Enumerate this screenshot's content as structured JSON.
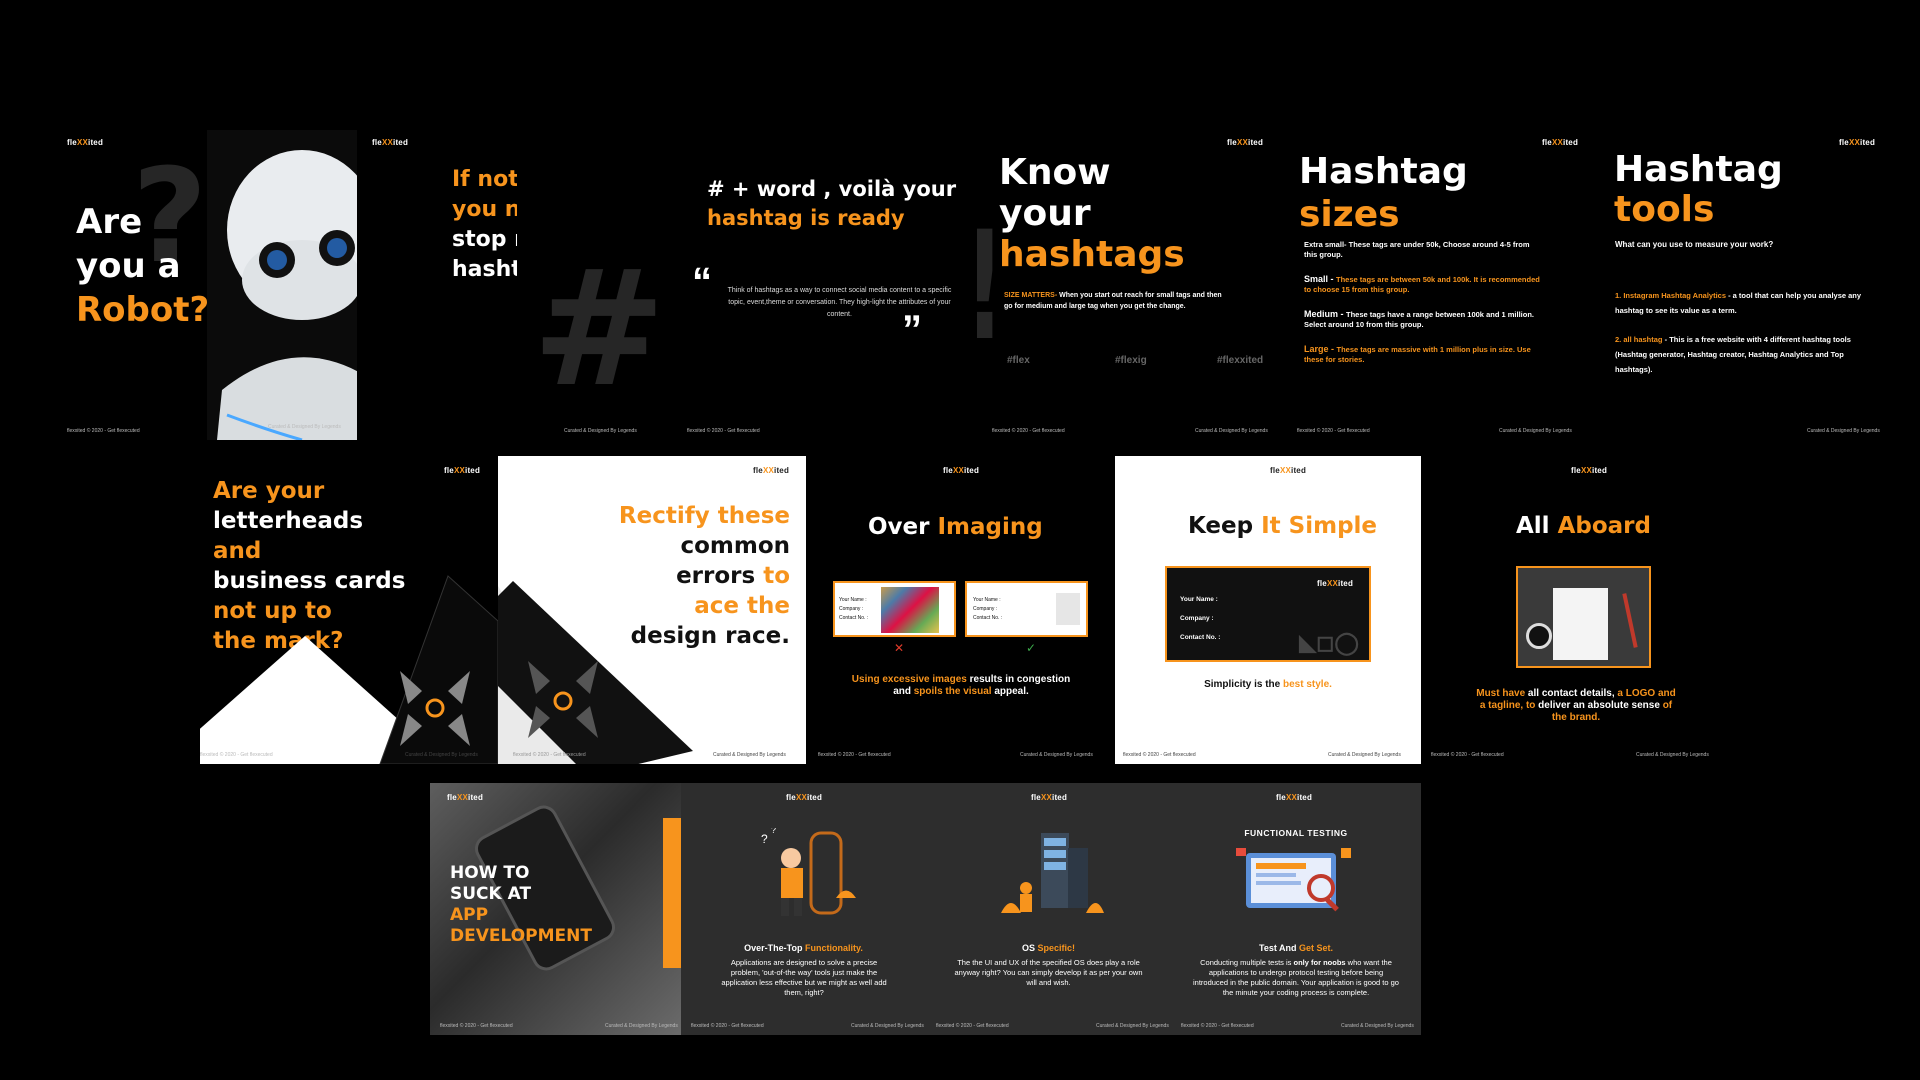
{
  "brand": {
    "logo": "fleXXited",
    "accent": "#f7941d"
  },
  "footers": {
    "copy": "flexxited © 2020 - Get flexecuted",
    "credit": "Curated & Designed By Legends"
  },
  "s1": {
    "l1": "Are",
    "l2": "you a",
    "l3": "Robot?"
  },
  "s2": {
    "l1": "If not then",
    "l2": "you need to",
    "l3": "stop repeating",
    "l4": "hashtags."
  },
  "s3": {
    "h1": "# + word , voilà your",
    "h2": "hashtag is ready",
    "quote": "Think of hashtags as a way to connect social media content to a specific topic, event,theme or conversation. They high-light the attributes of your content."
  },
  "s4": {
    "t1": "Know",
    "t2": "your",
    "t3": "hashtags",
    "sm_label": "SIZE MATTERS-",
    "sm_text": " When you start out reach for small tags and then go for medium and large tag when you get the change.",
    "tags": [
      "#flex",
      "#flexig",
      "#flexxited"
    ]
  },
  "s5": {
    "t1": "Hashtag",
    "t2": "sizes",
    "xs_label": "Extra small-",
    "xs_text": " These tags are under 50k, Choose around 4-5 from this group.",
    "sm_label": "Small - ",
    "sm_text": "These tags are between 50k and 100k. It is recommended to choose 15 from this group.",
    "md_label": "Medium - ",
    "md_text": "These tags have a range between 100k and 1 million. Select around 10 from this group.",
    "lg_label": "Large - ",
    "lg_text": "These tags are massive with 1 million plus in size. Use these for stories."
  },
  "s6": {
    "t1": "Hashtag",
    "t2": "tools",
    "q": "What can you use to measure your work?",
    "i1_label": "1. Instagram Hashtag Analytics",
    "i1_text": " - a tool that can help you analyse any hashtag to see its value as a term.",
    "i2_label": "2. all hashtag",
    "i2_text": " - This is a free website with 4 different hashtag tools (Hashtag generator, Hashtag creator, Hashtag Analytics and Top hashtags)."
  },
  "s7": {
    "l1": "Are your",
    "l2": "letterheads",
    "l3": "and",
    "l4": "business cards",
    "l5": "not up to",
    "l6": "the mark?"
  },
  "s8": {
    "l1": "Rectify these",
    "l2": "common",
    "l3": "errors",
    "l3b": " to",
    "l4": "ace the",
    "l5": "design race."
  },
  "s9": {
    "t1": "Over ",
    "t2": "Imaging",
    "card1": [
      "Your Name :",
      "Company :",
      "Contact No. :"
    ],
    "card2": [
      "Your Name :",
      "Company :",
      "Contact No. :"
    ],
    "d1": "Using excessive images",
    "d2": " results in congestion and ",
    "d3": "spoils the visual",
    "d4": " appeal.",
    "bad": "✕",
    "good": "✓"
  },
  "s10": {
    "t1": "Keep ",
    "t2": "It Simple",
    "card": [
      "Your Name :",
      "Company :",
      "Contact No. :"
    ],
    "d1": "Simplicity is the ",
    "d2": "best style."
  },
  "s11": {
    "t1": "All ",
    "t2": "Aboard",
    "d1": "Must have",
    "d2": " all contact details, ",
    "d3": "a LOGO",
    "d4": " and a tagline, to",
    "d5": " deliver an absolute sense ",
    "d6": "of the brand."
  },
  "s12": {
    "l1": "HOW TO",
    "l2": "SUCK AT",
    "l3": "APP",
    "l4": "DEVELOPMENT"
  },
  "s13": {
    "h1": "Over-The-Top ",
    "h2": "Functionality.",
    "text": "Applications are designed to solve a precise problem, 'out-of-the way' tools just make the application less effective but we might as well add them, right?"
  },
  "s14": {
    "h1": "OS ",
    "h2": "Specific!",
    "text": "The the UI and UX of the specified OS does play a role anyway right? You can simply develop it as per your own will and wish."
  },
  "s15": {
    "banner": "FUNCTIONAL TESTING",
    "h1": "Test And ",
    "h2": "Get Set.",
    "t1": "Conducting multiple tests is ",
    "t2": "only for noobs",
    "t3": " who want the applications to undergo protocol testing before being introduced in the public domain. Your application is good to go the minute your coding process is complete."
  }
}
